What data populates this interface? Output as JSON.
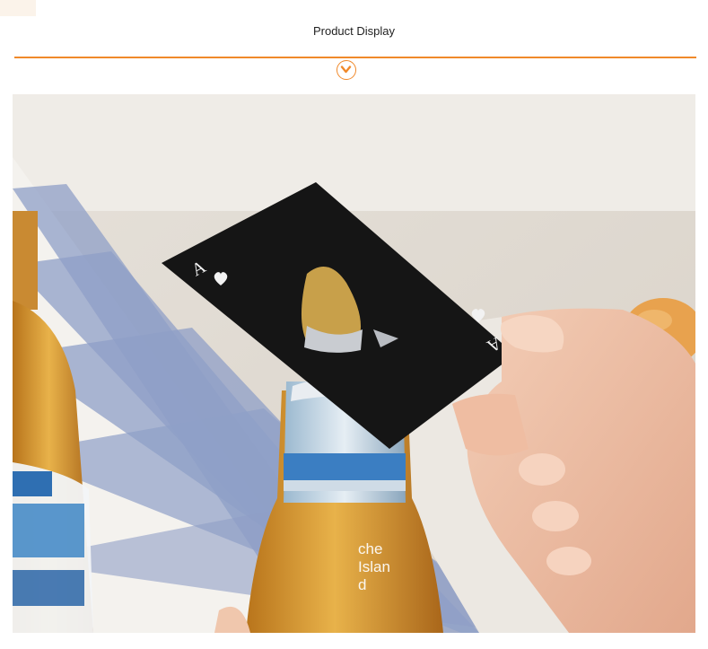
{
  "header": {
    "title": "Product Display"
  },
  "icons": {
    "section_arrow": "chevron-down-circle-icon"
  },
  "colors": {
    "accent": "#f0892a",
    "card": "#141414"
  },
  "photo": {
    "watermark_lines": [
      "che",
      "Islan",
      "d"
    ]
  }
}
